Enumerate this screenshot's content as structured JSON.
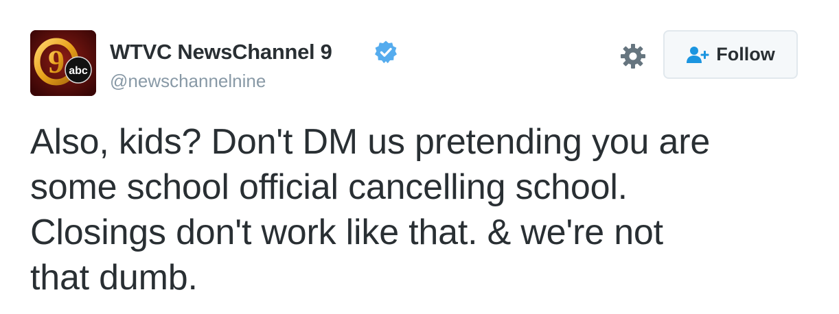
{
  "tweet": {
    "author": {
      "display_name": "WTVC NewsChannel 9",
      "handle": "@newschannelnine",
      "verified": true,
      "avatar": {
        "logo_numeral": "9",
        "logo_badge": "abc",
        "background_color": "#5a0c0c",
        "ring_color": "#e8a21c"
      }
    },
    "actions": {
      "follow_label": "Follow",
      "settings_icon": "gear-icon",
      "follow_icon": "add-user-icon"
    },
    "text": "Also, kids? Don't DM us pretending you are\nsome school official cancelling school.\nClosings don't work like that. & we're not\nthat dumb."
  },
  "colors": {
    "text": "#292f33",
    "secondary_text": "#8899a6",
    "verified_blue": "#55acee",
    "icon_gray": "#66757f",
    "button_bg": "#f5f8fa",
    "button_border": "#e1e8ed",
    "follow_icon_blue": "#1b95e0"
  }
}
